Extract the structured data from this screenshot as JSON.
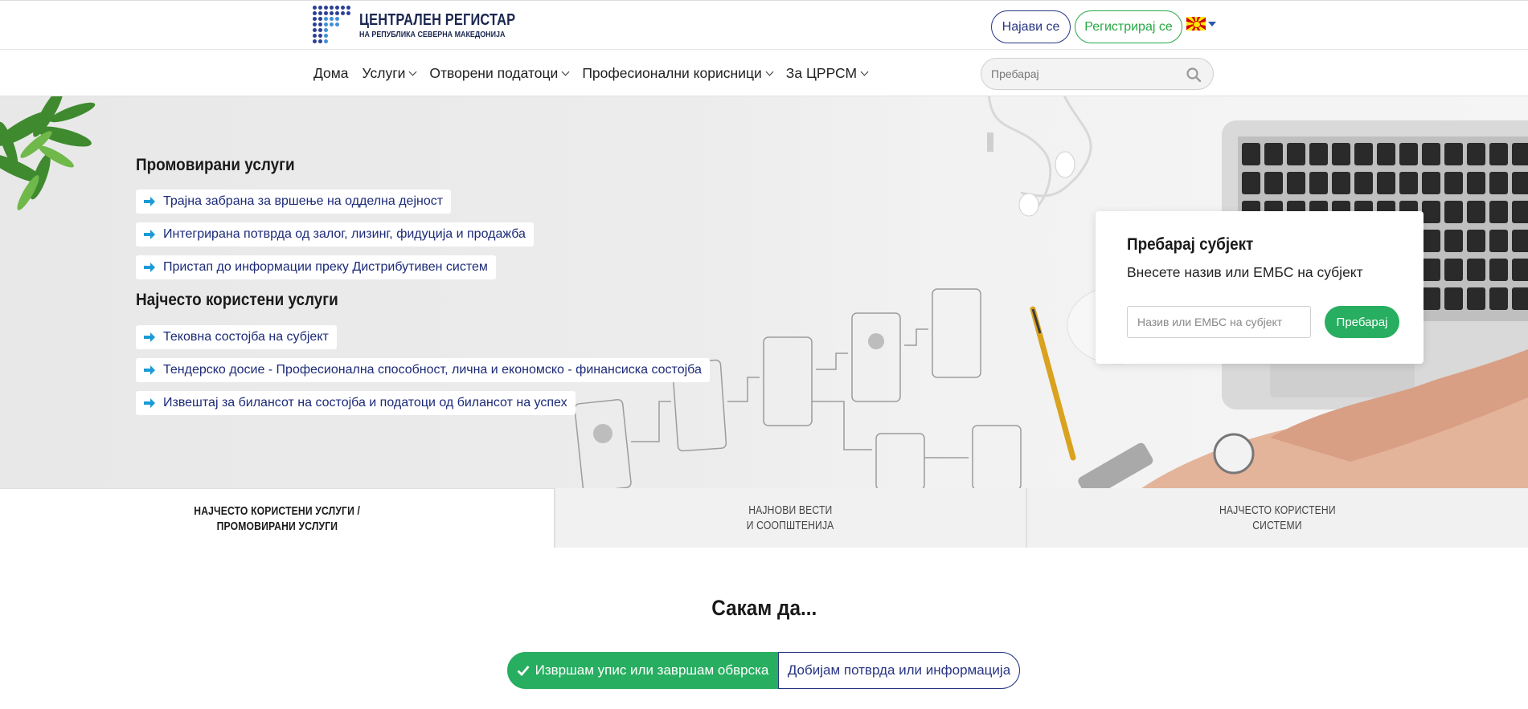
{
  "header": {
    "logo_title": "ЦЕНТРАЛЕН РЕГИСТАР",
    "logo_subtitle": "НА РЕПУБЛИКА СЕВЕРНА МАКЕДОНИЈА",
    "login_label": "Најави се",
    "register_label": "Регистрирај се",
    "language_flag": "macedonia-flag-icon"
  },
  "nav": {
    "items": [
      {
        "label": "Дома",
        "has_dropdown": false
      },
      {
        "label": "Услуги",
        "has_dropdown": true
      },
      {
        "label": "Отворени податоци",
        "has_dropdown": true
      },
      {
        "label": "Професионални корисници",
        "has_dropdown": true
      },
      {
        "label": "За ЦРРСМ",
        "has_dropdown": true
      }
    ],
    "search_placeholder": "Пребарај"
  },
  "hero": {
    "promoted_title": "Промовирани услуги",
    "promoted_items": [
      "Трајна забрана за вршење на одделна дејност",
      "Интегрирана потврда од залог, лизинг, фидуција и продажба",
      "Пристап до информации преку Дистрибутивен систем"
    ],
    "most_used_title": "Најчесто користени услуги",
    "most_used_items": [
      "Тековна состојба на субјект",
      "Тендерско досие - Професионална способност, лична и економско - финансиска состојба",
      "Извештај за билансот на состојба и податоци од билансот на успех"
    ]
  },
  "search_card": {
    "title": "Пребарај субјект",
    "subtitle": "Внесете назив или ЕМБС на субјект",
    "input_placeholder": "Назив или ЕМБС на субјект",
    "button_label": "Пребарај"
  },
  "tabs": [
    {
      "line1": "НАЈЧЕСТО КОРИСТЕНИ УСЛУГИ /",
      "line2": "ПРОМОВИРАНИ УСЛУГИ",
      "active": true
    },
    {
      "line1": "НАЈНОВИ ВЕСТИ",
      "line2": "И СООПШТЕНИЈА",
      "active": false
    },
    {
      "line1": "НАЈЧЕСТО КОРИСТЕНИ",
      "line2": "СИСТЕМИ",
      "active": false
    }
  ],
  "want": {
    "title": "Сакам да...",
    "option_active": "Извршам упис или завршам обврска",
    "option_inactive": "Добијам потврда или информација"
  },
  "colors": {
    "brand_navy": "#283583",
    "brand_green": "#27ae60",
    "link_blue": "#1c2a78",
    "arrow_blue": "#1a9ad6"
  }
}
